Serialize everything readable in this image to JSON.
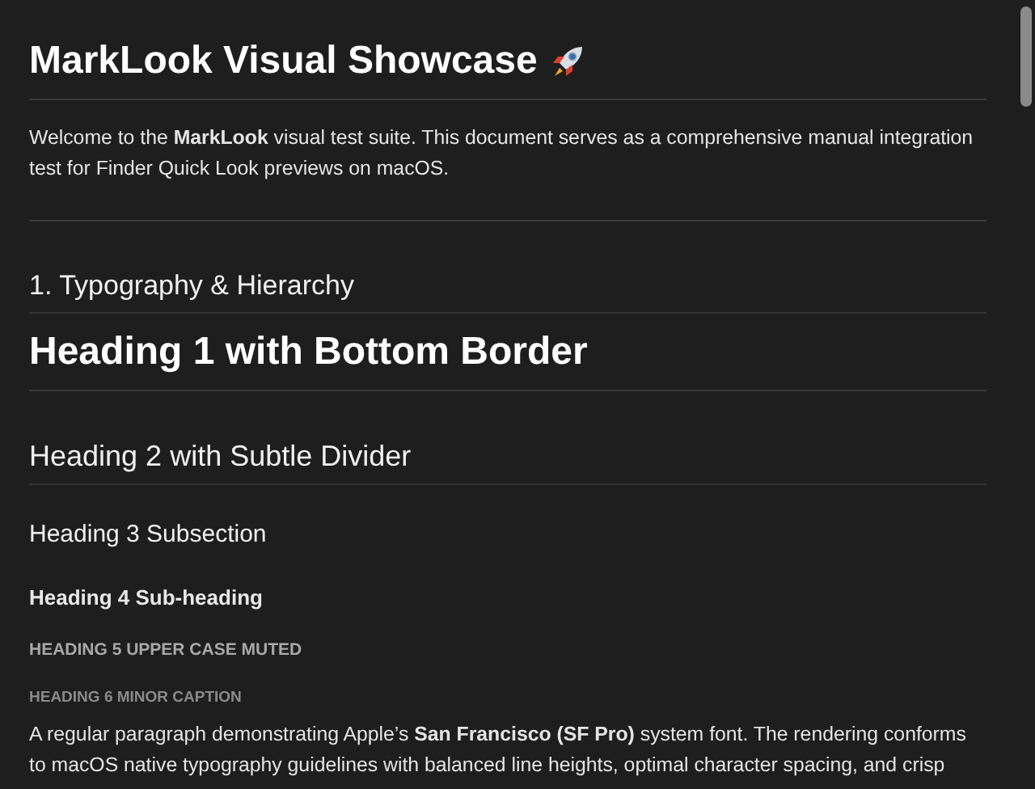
{
  "document": {
    "title": "MarkLook Visual Showcase",
    "intro": "Welcome to the **MarkLook** visual test suite. This document serves as a comprehensive manual integration test for Finder Quick Look previews on macOS.",
    "section_heading": "1. Typography & Hierarchy",
    "headings": [
      {
        "kind": "h1",
        "text": "Heading 1 with Bottom Border"
      },
      {
        "kind": "h2",
        "text": "Heading 2 with Subtle Divider"
      },
      {
        "kind": "h3",
        "text": "Heading 3 Subsection"
      },
      {
        "kind": "h4",
        "text": "Heading 4 Sub-heading"
      },
      {
        "kind": "h5",
        "text": "HEADING 5 UPPER CASE MUTED"
      },
      {
        "kind": "h6",
        "text": "HEADING 6 MINOR CAPTION"
      }
    ],
    "paragraph": "A regular paragraph demonstrating Apple’s **San Francisco (SF Pro)** system font. The rendering conforms to macOS native typography guidelines with balanced line heights, optimal character spacing, and crisp"
  }
}
